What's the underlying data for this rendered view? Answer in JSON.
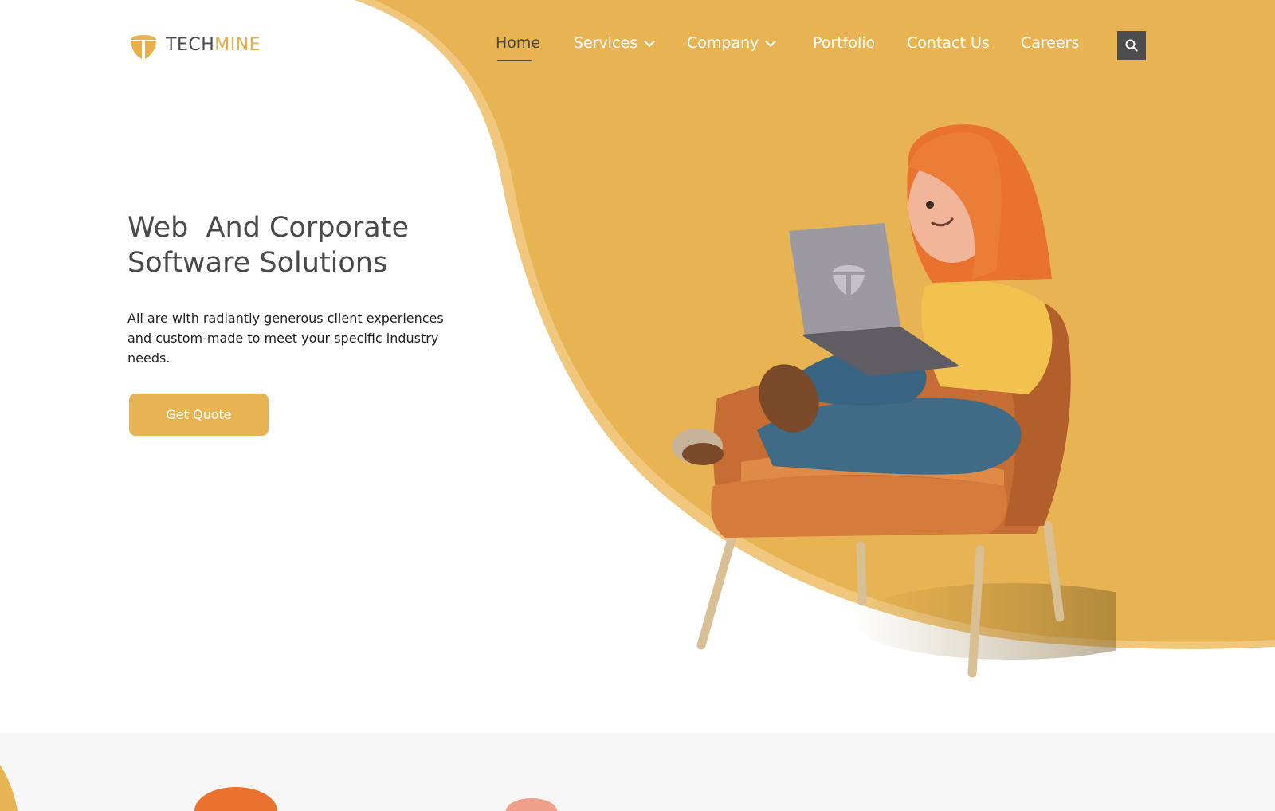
{
  "brand": {
    "name_part1": "TECH",
    "name_part2": "MINE"
  },
  "nav": {
    "items": [
      {
        "label": "Home",
        "active": true
      },
      {
        "label": "Services",
        "dropdown": true
      },
      {
        "label": "Company",
        "dropdown": true
      },
      {
        "label": "Portfolio"
      },
      {
        "label": "Contact Us"
      },
      {
        "label": "Careers"
      }
    ],
    "search_icon": "search-icon"
  },
  "hero": {
    "title_line1": "Web  And Corporate",
    "title_line2": "Software Solutions",
    "subtitle": "All are with radiantly generous client experiences and custom-made to meet your specific industry needs.",
    "cta_label": "Get Quote"
  },
  "colors": {
    "accent": "#e8b352",
    "accent_light": "#f0c77c",
    "text_dark": "#4a4a4a",
    "search_bg": "#4d4d4d",
    "band_bg": "#f6f6f6"
  }
}
